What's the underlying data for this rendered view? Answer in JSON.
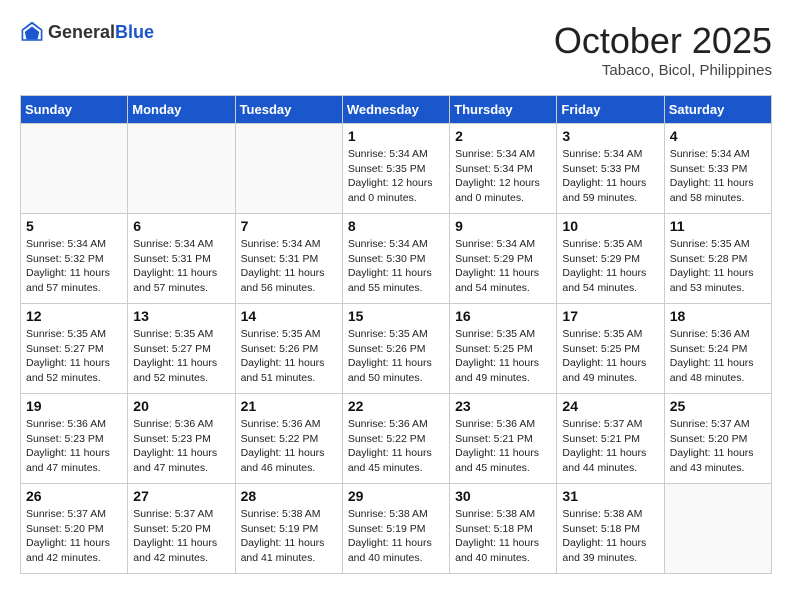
{
  "header": {
    "logo_general": "General",
    "logo_blue": "Blue",
    "month_title": "October 2025",
    "location": "Tabaco, Bicol, Philippines"
  },
  "days_of_week": [
    "Sunday",
    "Monday",
    "Tuesday",
    "Wednesday",
    "Thursday",
    "Friday",
    "Saturday"
  ],
  "weeks": [
    [
      {
        "day": "",
        "info": ""
      },
      {
        "day": "",
        "info": ""
      },
      {
        "day": "",
        "info": ""
      },
      {
        "day": "1",
        "info": "Sunrise: 5:34 AM\nSunset: 5:35 PM\nDaylight: 12 hours\nand 0 minutes."
      },
      {
        "day": "2",
        "info": "Sunrise: 5:34 AM\nSunset: 5:34 PM\nDaylight: 12 hours\nand 0 minutes."
      },
      {
        "day": "3",
        "info": "Sunrise: 5:34 AM\nSunset: 5:33 PM\nDaylight: 11 hours\nand 59 minutes."
      },
      {
        "day": "4",
        "info": "Sunrise: 5:34 AM\nSunset: 5:33 PM\nDaylight: 11 hours\nand 58 minutes."
      }
    ],
    [
      {
        "day": "5",
        "info": "Sunrise: 5:34 AM\nSunset: 5:32 PM\nDaylight: 11 hours\nand 57 minutes."
      },
      {
        "day": "6",
        "info": "Sunrise: 5:34 AM\nSunset: 5:31 PM\nDaylight: 11 hours\nand 57 minutes."
      },
      {
        "day": "7",
        "info": "Sunrise: 5:34 AM\nSunset: 5:31 PM\nDaylight: 11 hours\nand 56 minutes."
      },
      {
        "day": "8",
        "info": "Sunrise: 5:34 AM\nSunset: 5:30 PM\nDaylight: 11 hours\nand 55 minutes."
      },
      {
        "day": "9",
        "info": "Sunrise: 5:34 AM\nSunset: 5:29 PM\nDaylight: 11 hours\nand 54 minutes."
      },
      {
        "day": "10",
        "info": "Sunrise: 5:35 AM\nSunset: 5:29 PM\nDaylight: 11 hours\nand 54 minutes."
      },
      {
        "day": "11",
        "info": "Sunrise: 5:35 AM\nSunset: 5:28 PM\nDaylight: 11 hours\nand 53 minutes."
      }
    ],
    [
      {
        "day": "12",
        "info": "Sunrise: 5:35 AM\nSunset: 5:27 PM\nDaylight: 11 hours\nand 52 minutes."
      },
      {
        "day": "13",
        "info": "Sunrise: 5:35 AM\nSunset: 5:27 PM\nDaylight: 11 hours\nand 52 minutes."
      },
      {
        "day": "14",
        "info": "Sunrise: 5:35 AM\nSunset: 5:26 PM\nDaylight: 11 hours\nand 51 minutes."
      },
      {
        "day": "15",
        "info": "Sunrise: 5:35 AM\nSunset: 5:26 PM\nDaylight: 11 hours\nand 50 minutes."
      },
      {
        "day": "16",
        "info": "Sunrise: 5:35 AM\nSunset: 5:25 PM\nDaylight: 11 hours\nand 49 minutes."
      },
      {
        "day": "17",
        "info": "Sunrise: 5:35 AM\nSunset: 5:25 PM\nDaylight: 11 hours\nand 49 minutes."
      },
      {
        "day": "18",
        "info": "Sunrise: 5:36 AM\nSunset: 5:24 PM\nDaylight: 11 hours\nand 48 minutes."
      }
    ],
    [
      {
        "day": "19",
        "info": "Sunrise: 5:36 AM\nSunset: 5:23 PM\nDaylight: 11 hours\nand 47 minutes."
      },
      {
        "day": "20",
        "info": "Sunrise: 5:36 AM\nSunset: 5:23 PM\nDaylight: 11 hours\nand 47 minutes."
      },
      {
        "day": "21",
        "info": "Sunrise: 5:36 AM\nSunset: 5:22 PM\nDaylight: 11 hours\nand 46 minutes."
      },
      {
        "day": "22",
        "info": "Sunrise: 5:36 AM\nSunset: 5:22 PM\nDaylight: 11 hours\nand 45 minutes."
      },
      {
        "day": "23",
        "info": "Sunrise: 5:36 AM\nSunset: 5:21 PM\nDaylight: 11 hours\nand 45 minutes."
      },
      {
        "day": "24",
        "info": "Sunrise: 5:37 AM\nSunset: 5:21 PM\nDaylight: 11 hours\nand 44 minutes."
      },
      {
        "day": "25",
        "info": "Sunrise: 5:37 AM\nSunset: 5:20 PM\nDaylight: 11 hours\nand 43 minutes."
      }
    ],
    [
      {
        "day": "26",
        "info": "Sunrise: 5:37 AM\nSunset: 5:20 PM\nDaylight: 11 hours\nand 42 minutes."
      },
      {
        "day": "27",
        "info": "Sunrise: 5:37 AM\nSunset: 5:20 PM\nDaylight: 11 hours\nand 42 minutes."
      },
      {
        "day": "28",
        "info": "Sunrise: 5:38 AM\nSunset: 5:19 PM\nDaylight: 11 hours\nand 41 minutes."
      },
      {
        "day": "29",
        "info": "Sunrise: 5:38 AM\nSunset: 5:19 PM\nDaylight: 11 hours\nand 40 minutes."
      },
      {
        "day": "30",
        "info": "Sunrise: 5:38 AM\nSunset: 5:18 PM\nDaylight: 11 hours\nand 40 minutes."
      },
      {
        "day": "31",
        "info": "Sunrise: 5:38 AM\nSunset: 5:18 PM\nDaylight: 11 hours\nand 39 minutes."
      },
      {
        "day": "",
        "info": ""
      }
    ]
  ]
}
